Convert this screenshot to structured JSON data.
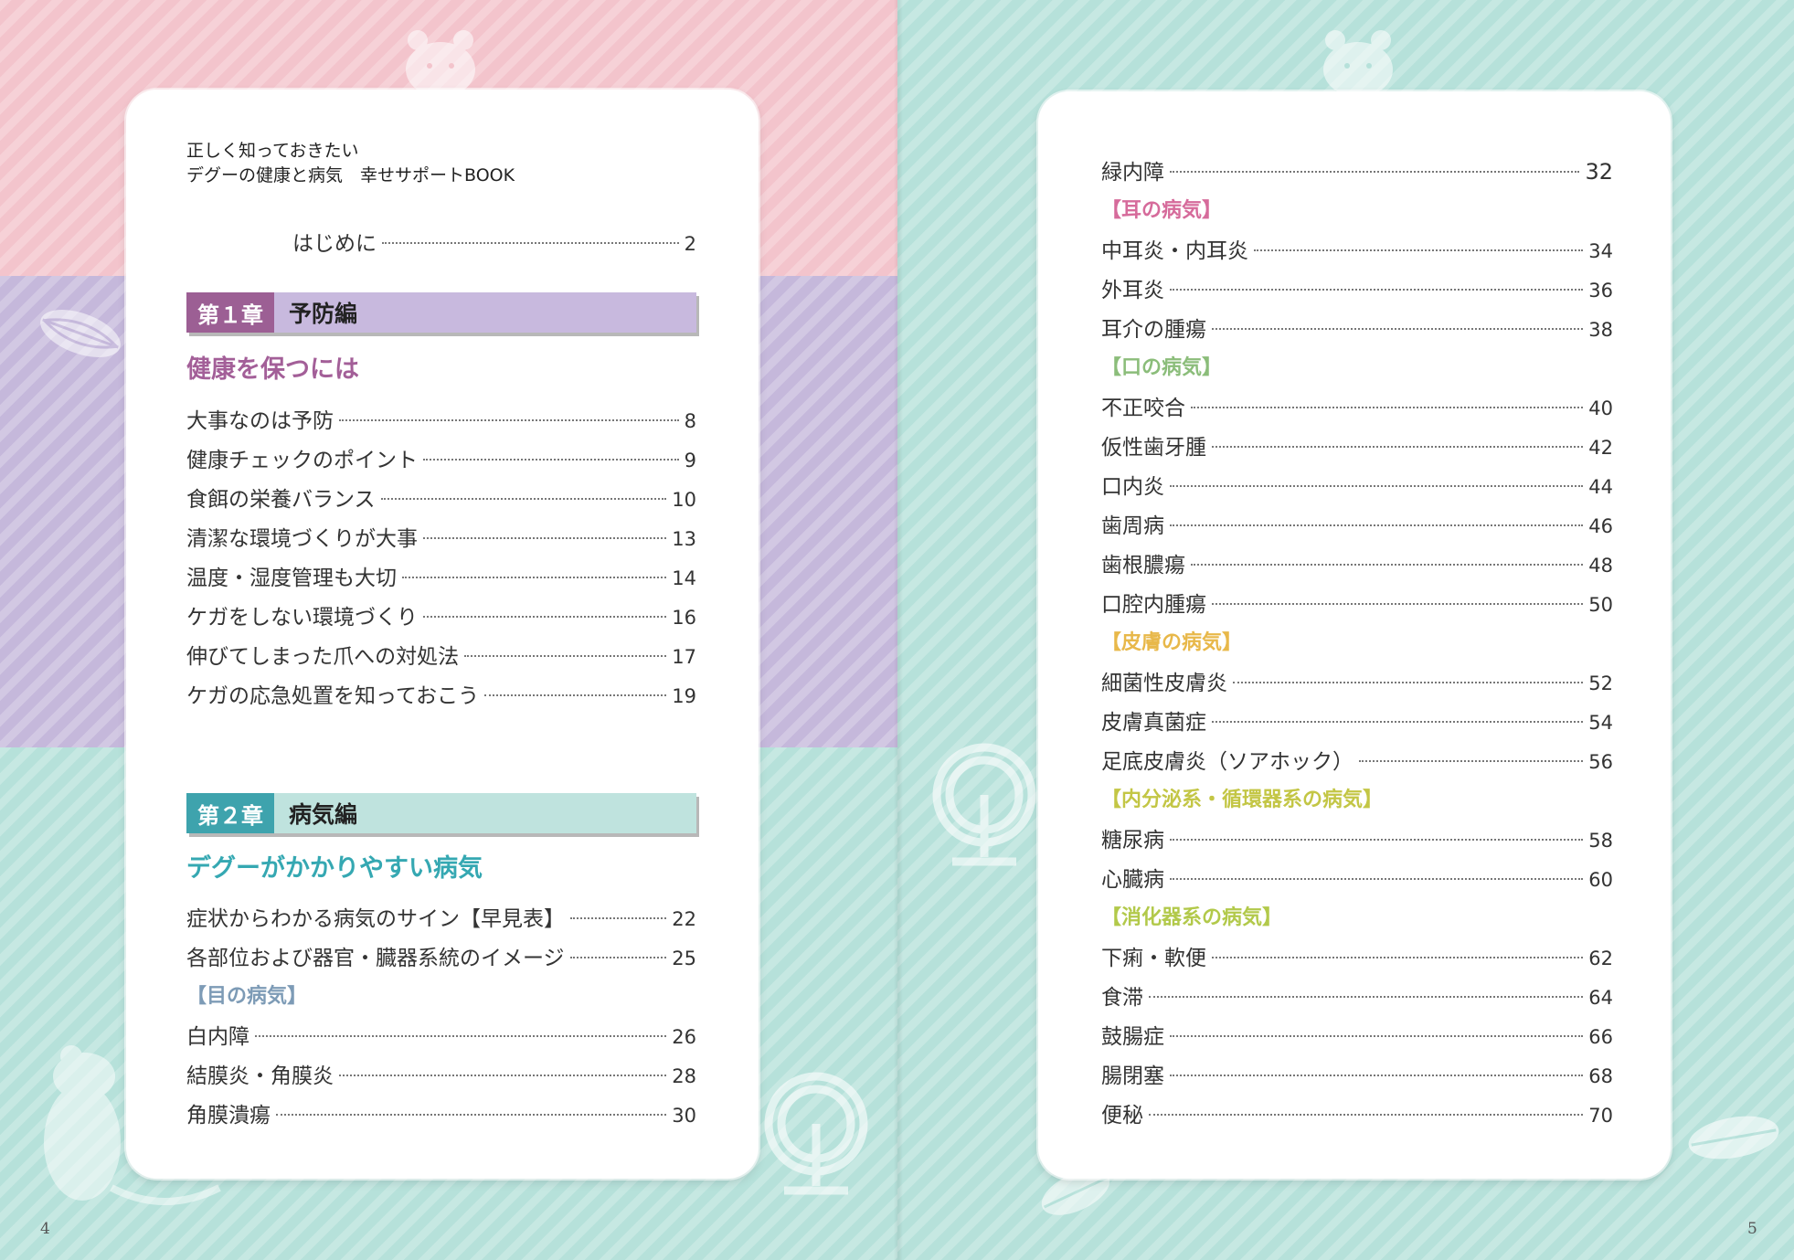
{
  "book_title": {
    "line1": "正しく知っておきたい",
    "line2": "デグーの健康と病気　幸せサポートBOOK"
  },
  "intro": {
    "label": "はじめに",
    "page": "2"
  },
  "chapters": [
    {
      "number": "第１章",
      "name": "予防編",
      "heading": "健康を保つには",
      "items": [
        {
          "label": "大事なのは予防",
          "page": "8"
        },
        {
          "label": "健康チェックのポイント",
          "page": "9"
        },
        {
          "label": "食餌の栄養バランス",
          "page": "10"
        },
        {
          "label": "清潔な環境づくりが大事",
          "page": "13"
        },
        {
          "label": "温度・湿度管理も大切",
          "page": "14"
        },
        {
          "label": "ケガをしない環境づくり",
          "page": "16"
        },
        {
          "label": "伸びてしまった爪への対処法",
          "page": "17"
        },
        {
          "label": "ケガの応急処置を知っておこう",
          "page": "19"
        }
      ]
    },
    {
      "number": "第２章",
      "name": "病気編",
      "heading": "デグーがかかりやすい病気",
      "items": [
        {
          "label": "症状からわかる病気のサイン【早見表】",
          "page": "22"
        },
        {
          "label": "各部位および器官・臓器系統のイメージ",
          "page": "25"
        }
      ]
    }
  ],
  "eye_category": {
    "title": "【目の病気】",
    "items": [
      {
        "label": "白内障",
        "page": "26"
      },
      {
        "label": "結膜炎・角膜炎",
        "page": "28"
      },
      {
        "label": "角膜潰瘍",
        "page": "30"
      }
    ]
  },
  "right_top_item": {
    "label": "緑内障",
    "page": "32"
  },
  "right_categories": [
    {
      "title": "【耳の病気】",
      "color": "#d66b9b",
      "items": [
        {
          "label": "中耳炎・内耳炎",
          "page": "34"
        },
        {
          "label": "外耳炎",
          "page": "36"
        },
        {
          "label": "耳介の腫瘍",
          "page": "38"
        }
      ]
    },
    {
      "title": "【口の病気】",
      "color": "#8bbd7a",
      "items": [
        {
          "label": "不正咬合",
          "page": "40"
        },
        {
          "label": "仮性歯牙腫",
          "page": "42"
        },
        {
          "label": "口内炎",
          "page": "44"
        },
        {
          "label": "歯周病",
          "page": "46"
        },
        {
          "label": "歯根膿瘍",
          "page": "48"
        },
        {
          "label": "口腔内腫瘍",
          "page": "50"
        }
      ]
    },
    {
      "title": "【皮膚の病気】",
      "color": "#e8b84a",
      "items": [
        {
          "label": "細菌性皮膚炎",
          "page": "52"
        },
        {
          "label": "皮膚真菌症",
          "page": "54"
        },
        {
          "label": "足底皮膚炎（ソアホック）",
          "page": "56"
        }
      ]
    },
    {
      "title": "【内分泌系・循環器系の病気】",
      "color": "#c3c645",
      "items": [
        {
          "label": "糖尿病",
          "page": "58"
        },
        {
          "label": "心臓病",
          "page": "60"
        }
      ]
    },
    {
      "title": "【消化器系の病気】",
      "color": "#b2c94a",
      "items": [
        {
          "label": "下痢・軟便",
          "page": "62"
        },
        {
          "label": "食滞",
          "page": "64"
        },
        {
          "label": "鼓腸症",
          "page": "66"
        },
        {
          "label": "腸閉塞",
          "page": "68"
        },
        {
          "label": "便秘",
          "page": "70"
        }
      ]
    }
  ],
  "folios": {
    "left": "4",
    "right": "5"
  },
  "colors": {
    "pink_bg": "#f3c4cc",
    "purple_bg": "#c5b8db",
    "mint_bg": "#b6e1da",
    "chapter1_num": "#9c5f94",
    "chapter1_bar": "#c8b9de",
    "chapter1_heading": "#a35f98",
    "chapter2_num": "#3ea3ad",
    "chapter2_bar": "#bfe3de",
    "chapter2_heading": "#35a8b2",
    "eye_category": "#7d9bb6"
  },
  "decorations": [
    "hamster-icon",
    "sunflower-seed-icon",
    "hamster-wheel-icon",
    "degu-silhouette-icon"
  ]
}
